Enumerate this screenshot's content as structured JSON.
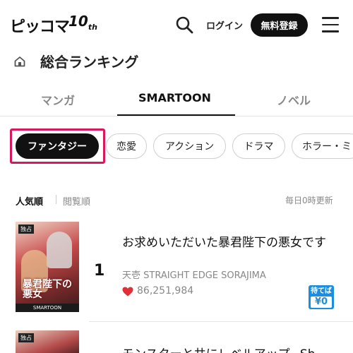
{
  "header": {
    "logo_text": "ピッコマ",
    "logo_badge": "10",
    "logo_badge_suffix": "th",
    "login_label": "ログイン",
    "register_label": "無料登録"
  },
  "page": {
    "title": "総合ランキング"
  },
  "tabs": [
    {
      "label": "マンガ",
      "active": false
    },
    {
      "label": "SMARTOON",
      "active": true
    },
    {
      "label": "ノベル",
      "active": false
    }
  ],
  "genres": [
    {
      "label": "ファンタジー",
      "active": true
    },
    {
      "label": "恋愛",
      "active": false
    },
    {
      "label": "アクション",
      "active": false
    },
    {
      "label": "ドラマ",
      "active": false
    },
    {
      "label": "ホラー・ミ",
      "active": false
    }
  ],
  "sort": {
    "options": [
      {
        "label": "人気順",
        "active": true
      },
      {
        "label": "閲覧順",
        "active": false
      }
    ],
    "update_note": "毎日0時更新"
  },
  "ranking": [
    {
      "rank": "1",
      "title": "お求めいただいた暴君陛下の悪女です",
      "author": "天壱 STRAIGHT EDGE SORAJIMA",
      "likes": "86,251,984",
      "thumb_tag": "独占",
      "thumb_title": "暴君陛下の悪女",
      "thumb_footer": "SMARTOON",
      "wait_badge_top": "待てば",
      "wait_badge_bottom": "¥0"
    },
    {
      "title": "モンスターと共にレベルアップ~Sh",
      "thumb_tag": "独占"
    }
  ],
  "colors": {
    "accent_highlight": "#d9175f",
    "wait_badge": "#1a8ee0",
    "heart": "#e0303a"
  }
}
